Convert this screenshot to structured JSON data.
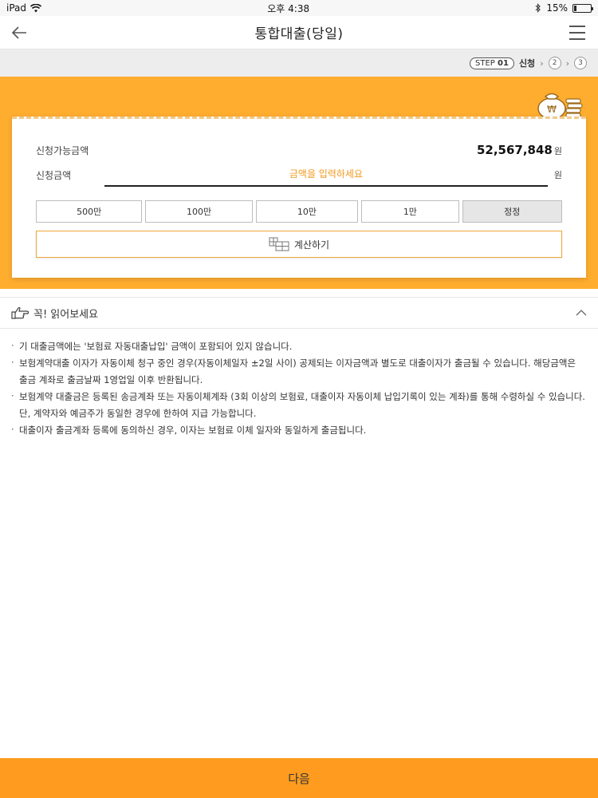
{
  "status_bar": {
    "device": "iPad",
    "time": "오후 4:38",
    "battery": "15%",
    "battery_level": 0.15
  },
  "header": {
    "title": "통합대출(당일)",
    "back_icon": "arrow-left-icon",
    "menu_icon": "hamburger-menu-icon"
  },
  "steps": {
    "step_word": "STEP",
    "current_number": "01",
    "current_label": "신청",
    "next_steps": [
      "2",
      "3"
    ]
  },
  "loan": {
    "available_label": "신청가능금액",
    "available_amount": "52,567,848",
    "currency_unit": "원",
    "request_label": "신청금액",
    "request_placeholder": "금액을 입력하세요",
    "request_value": "",
    "quick_buttons": [
      "500만",
      "100만",
      "10만",
      "1만",
      "정정"
    ],
    "calc_label": "계산하기"
  },
  "notice": {
    "title": "꼭! 읽어보세요",
    "items": [
      "기 대출금액에는 '보험료 자동대출납입' 금액이 포함되어 있지 않습니다.",
      "보험계약대출 이자가 자동이체 청구 중인 경우(자동이체일자 ±2일 사이) 공제되는 이자금액과 별도로 대출이자가 출금될 수 있습니다. 해당금액은 출금 계좌로 출금날짜 1영업일 이후 반환됩니다.",
      "보험계약 대출금은 등록된 송금계좌 또는 자동이체계좌 (3회 이상의 보험료, 대출이자 자동이체 납입기록이 있는 계좌)를 통해 수령하실 수 있습니다. 단, 계약자와 예금주가 동일한 경우에 한하여 지급 가능합니다.",
      "대출이자 출금계좌 등록에 동의하신 경우, 이자는 보험료 이체 일자와 동일하게 출금됩니다."
    ]
  },
  "footer": {
    "next_label": "다음"
  },
  "colors": {
    "accent_orange": "#ffad2f",
    "button_orange": "#ff9c1f",
    "placeholder_orange": "#f49a20"
  }
}
